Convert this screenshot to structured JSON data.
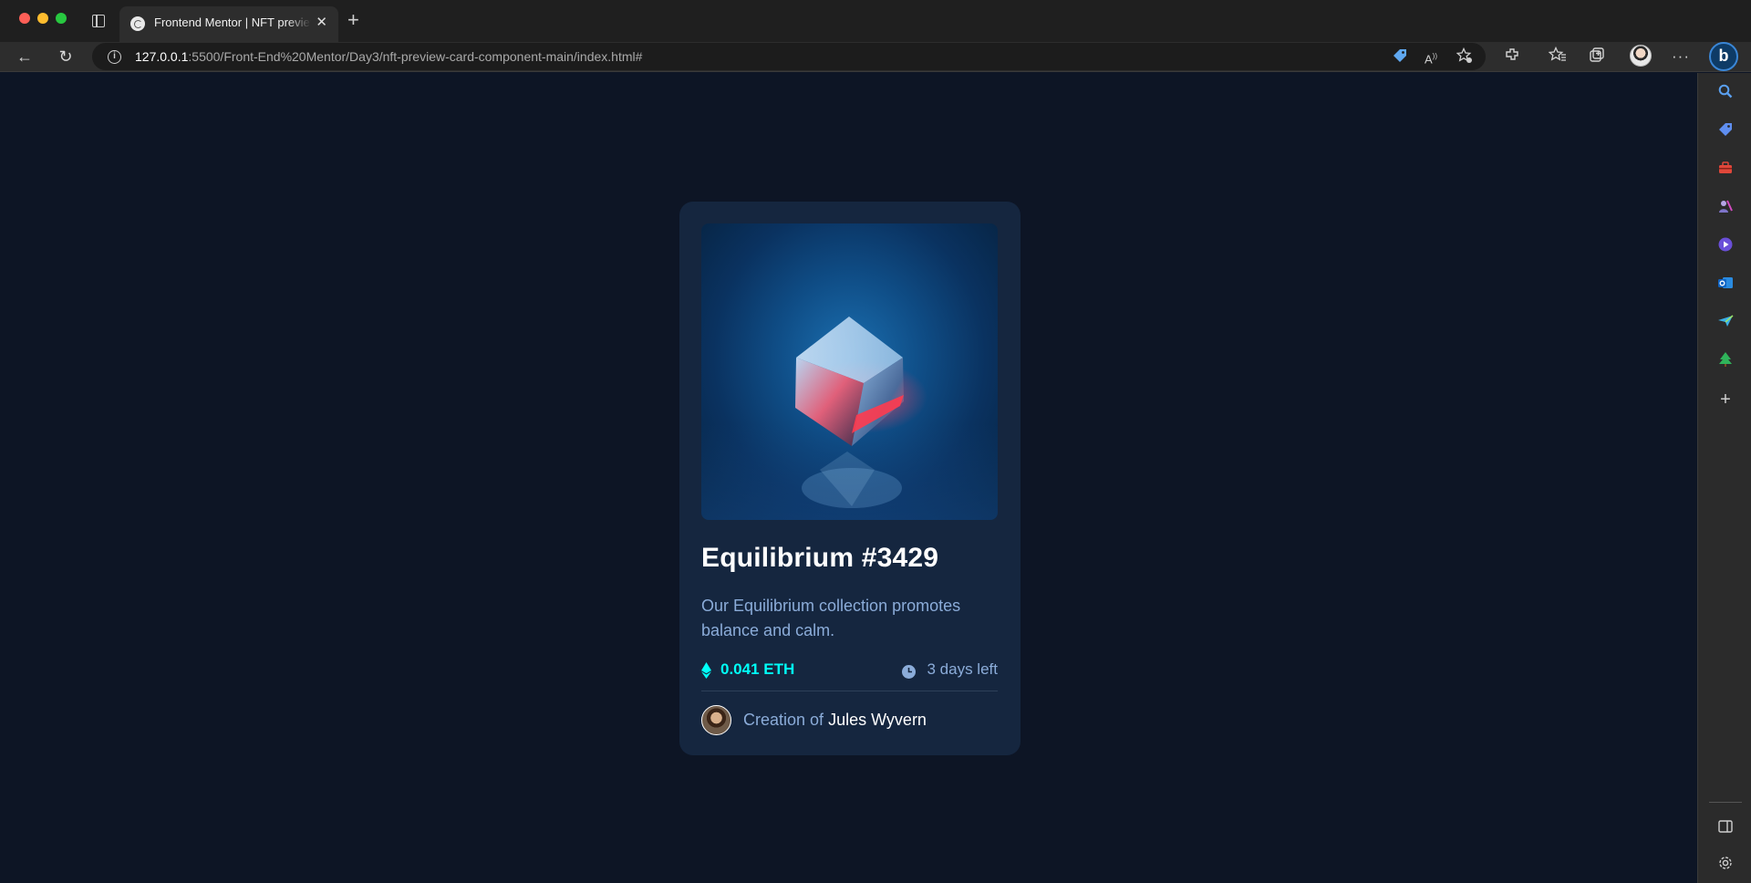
{
  "browser": {
    "tab_title": "Frontend Mentor | NFT preview card component",
    "tab_close": "✕",
    "new_tab": "+",
    "url_host": "127.0.0.1",
    "url_path": ":5500/Front-End%20Mentor/Day3/nft-preview-card-component-main/index.html#",
    "back": "←",
    "reload": "↻",
    "info": "i",
    "more": "···",
    "bing": "b"
  },
  "card": {
    "title": "Equilibrium #3429",
    "description": "Our Equilibrium collection promotes balance and calm.",
    "price": "0.041 ETH",
    "time_left": "3 days left",
    "creator_prefix": "Creation of",
    "creator_name": "Jules Wyvern"
  },
  "colors": {
    "page_bg": "#0d1525",
    "card_bg": "#15263f",
    "cyan": "#00fff8",
    "soft_blue": "#8bacd9",
    "white": "#ffffff"
  },
  "icons": {
    "toolbar": [
      "shopping-tag-icon",
      "read-aloud-icon",
      "add-favorite-icon",
      "extensions-icon",
      "favorites-icon",
      "collections-icon",
      "profile-avatar",
      "more-icon",
      "bing-chat-icon"
    ],
    "sidebar": [
      "search-icon",
      "shopping-icon",
      "tools-icon",
      "games-icon",
      "copilot-icon",
      "outlook-icon",
      "send-icon",
      "tree-icon",
      "add-icon",
      "split-screen-icon",
      "settings-icon"
    ]
  }
}
